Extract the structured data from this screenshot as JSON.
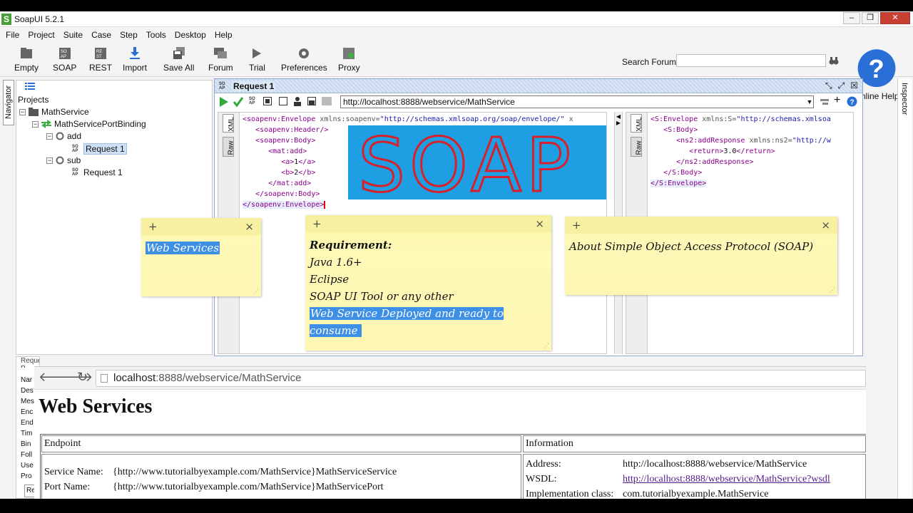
{
  "window": {
    "title": "SoapUI 5.2.1",
    "app_icon": "S"
  },
  "menu": [
    "File",
    "Project",
    "Suite",
    "Case",
    "Step",
    "Tools",
    "Desktop",
    "Help"
  ],
  "toolbar": {
    "items": [
      "Empty",
      "SOAP",
      "REST",
      "Import",
      "Save All",
      "Forum",
      "Trial",
      "Preferences",
      "Proxy"
    ],
    "search_label": "Search Forum",
    "help_label": "Online Help"
  },
  "navigator_label": "Navigator",
  "inspector_label": "Inspector",
  "tree": {
    "header": "Projects",
    "project": "MathService",
    "binding": "MathServicePortBinding",
    "op1": "add",
    "op1_request": "Request 1",
    "op2": "sub",
    "op2_request": "Request 1"
  },
  "request": {
    "title": "Request 1",
    "endpoint": "http://localhost:8888/webservice/MathService",
    "tab_xml": "XML",
    "tab_raw": "Raw"
  },
  "request_xml": {
    "l1_tag": "<soapenv:Envelope",
    "l1_attr": " xmlns:soapenv=",
    "l1_val": "\"http://schemas.xmlsoap.org/soap/envelope/\"",
    "l1_more": " x",
    "l2": "<soapenv:Header/>",
    "l3": "<soapenv:Body>",
    "l4": "<mat:add>",
    "l5_open": "<a>",
    "l5_text": "1",
    "l5_close": "</a>",
    "l6_open": "<b>",
    "l6_text": "2",
    "l6_close": "</b>",
    "l7": "</mat:add>",
    "l8": "</soapenv:Body>",
    "l9": "</soapenv:Envelope>"
  },
  "response_xml": {
    "l1_tag": "<S:Envelope",
    "l1_attr": " xmlns:S=",
    "l1_val": "\"http://schemas.xmlsoa",
    "l2": "<S:Body>",
    "l3_tag": "<ns2:addResponse",
    "l3_attr": " xmlns:ns2=",
    "l3_val": "\"http://w",
    "l4_open": "<return>",
    "l4_text": "3.0",
    "l4_close": "</return>",
    "l5": "</ns2:addResponse>",
    "l6": "</S:Body>",
    "l7": "</S:Envelope>"
  },
  "soap_banner": "SOAP",
  "notes": {
    "n1": "Web Services",
    "n2_title": "Requirement:",
    "n2_l1": "Java 1.6+",
    "n2_l2": "Eclipse",
    "n2_l3": "SOAP UI Tool or any other",
    "n2_l4": "Web Service Deployed and ready to consume",
    "n3": "About Simple Object Access Protocol (SOAP)",
    "plus": "+",
    "close": "×"
  },
  "props_rows": [
    "Nar",
    "Des",
    "Mes",
    "Enc",
    "End",
    "Tim",
    "Bin",
    "Foll",
    "Use",
    "Pro"
  ],
  "props_tab": "Re",
  "props_header": "Request P",
  "browser": {
    "url_host": "localhost",
    "url_rest": ":8888/webservice/MathService",
    "heading": "Web Services",
    "col_endpoint": "Endpoint",
    "col_info": "Information",
    "service_name_label": "Service Name:",
    "service_name_value": "{http://www.tutorialbyexample.com/MathService}MathServiceService",
    "port_name_label": "Port Name:",
    "port_name_value": "{http://www.tutorialbyexample.com/MathService}MathServicePort",
    "address_label": "Address:",
    "address_value": "http://localhost:8888/webservice/MathService",
    "wsdl_label": "WSDL:",
    "wsdl_value": "http://localhost:8888/webservice/MathService?wsdl",
    "impl_label": "Implementation class:",
    "impl_value": "com.tutorialbyexample.MathService"
  }
}
